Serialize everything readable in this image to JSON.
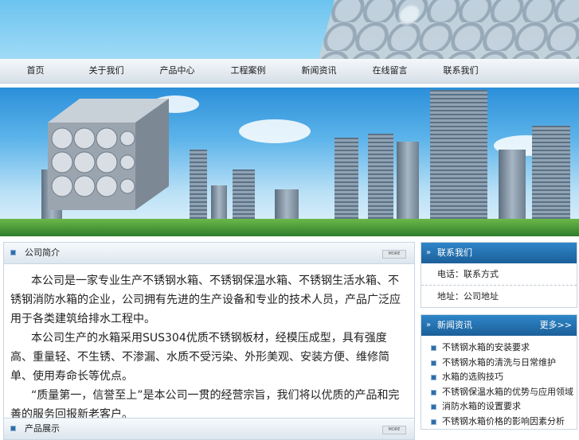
{
  "nav": {
    "items": [
      "首页",
      "关于我们",
      "产品中心",
      "工程案例",
      "新闻资讯",
      "在线留言",
      "联系我们"
    ]
  },
  "main": {
    "section_title": "公司简介",
    "more_label": "MORE",
    "paragraphs": [
      "本公司是一家专业生产不锈钢水箱、不锈钢保温水箱、不锈钢生活水箱、不锈钢消防水箱的企业，公司拥有先进的生产设备和专业的技术人员，产品广泛应用于各类建筑给排水工程中。",
      "本公司生产的水箱采用SUS304优质不锈钢板材，经模压成型，具有强度高、重量轻、不生锈、不渗漏、水质不受污染、外形美观、安装方便、维修简单、使用寿命长等优点。",
      "“质量第一，信誉至上”是本公司一贯的经营宗旨，我们将以优质的产品和完善的服务回报新老客户。"
    ],
    "section2_title": "产品展示"
  },
  "side": {
    "contact": {
      "title": "联系我们",
      "lines": [
        "电话：联系方式",
        "地址：公司地址"
      ]
    },
    "news": {
      "title": "新闻资讯",
      "more_label": "更多>>",
      "items": [
        "不锈钢水箱的安装要求",
        "不锈钢水箱的清洗与日常维护",
        "水箱的选购技巧",
        "不锈钢保温水箱的优势与应用领域",
        "消防水箱的设置要求",
        "不锈钢水箱价格的影响因素分析"
      ]
    }
  },
  "colors": {
    "accent": "#1b5f99",
    "sky": "#6cc3ef"
  }
}
